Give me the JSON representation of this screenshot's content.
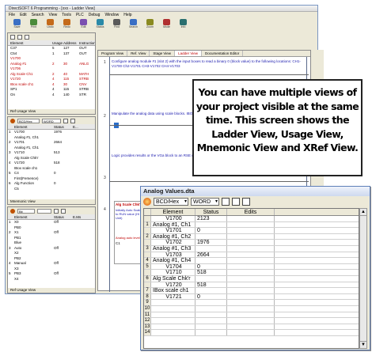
{
  "app": {
    "title": "DirectSOFT 6 Programming - [xxx - Ladder View]",
    "menu": [
      "File",
      "Edit",
      "Search",
      "View",
      "Tools",
      "PLC",
      "Debug",
      "Window",
      "Help"
    ],
    "toolbar": [
      {
        "label": "Save",
        "icon": "save-icon"
      },
      {
        "label": "Print",
        "icon": "print-icon"
      },
      {
        "label": "Undo",
        "icon": "undo-icon"
      },
      {
        "label": "Redo",
        "icon": "redo-icon"
      },
      {
        "label": "Edit",
        "icon": "edit-icon"
      },
      {
        "label": "Status",
        "icon": "status-icon"
      },
      {
        "label": "Find",
        "icon": "find-icon"
      },
      {
        "label": "Search",
        "icon": "search-icon"
      },
      {
        "label": "Zoom",
        "icon": "zoom-icon"
      },
      {
        "label": "Mode",
        "icon": "mode-icon"
      },
      {
        "label": "Info",
        "icon": "info-icon"
      }
    ],
    "colors": {
      "accent": "#c00000",
      "comment": "#2020b0",
      "panel": "#ece9d8"
    }
  },
  "usage": {
    "headers": [
      "Element",
      "Usage",
      "Address",
      "Instruction"
    ],
    "rows": [
      {
        "element": "C37",
        "usage": "5",
        "address": "127",
        "instr": "OUT",
        "red": false
      },
      {
        "element": "C54",
        "usage": "1",
        "address": "137",
        "instr": "OUT",
        "red": false
      },
      {
        "element": "V1700",
        "usage": "",
        "address": "",
        "instr": "",
        "red": true
      },
      {
        "element": "Analog #1",
        "usage": "2",
        "address": "30",
        "instr": "ANLG",
        "red": true
      },
      {
        "element": "V1706",
        "usage": "",
        "address": "",
        "instr": "",
        "red": true
      },
      {
        "element": "Alg Scale Ch1",
        "usage": "2",
        "address": "40",
        "instr": "MATH",
        "red": true
      },
      {
        "element": "V1720",
        "usage": "4",
        "address": "115",
        "instr": "STRB",
        "red": true
      },
      {
        "element": "IBox scale ch1",
        "usage": "4",
        "address": "30",
        "instr": "CNV",
        "red": true
      },
      {
        "element": "SP1",
        "usage": "4",
        "address": "115",
        "instr": "STRB",
        "red": false
      },
      {
        "element": "On",
        "usage": "4",
        "address": "140",
        "instr": "STR",
        "red": false
      }
    ],
    "status": "Ref Usage View"
  },
  "mnemonic": {
    "format": "BCD/Hex",
    "type": "WORD",
    "headers": [
      "Element",
      "Status",
      "E..."
    ],
    "rows": [
      {
        "n": "1",
        "element": "V1700",
        "status": "1976"
      },
      {
        "n": "",
        "element": "Analog #1, Ch1",
        "status": ""
      },
      {
        "n": "2",
        "element": "V1701",
        "status": "2664"
      },
      {
        "n": "",
        "element": "Analog #1, Ch1",
        "status": ""
      },
      {
        "n": "3",
        "element": "V1710",
        "status": "513"
      },
      {
        "n": "",
        "element": "Alg Scale Chk'r",
        "status": ""
      },
      {
        "n": "4",
        "element": "V1720",
        "status": "518"
      },
      {
        "n": "",
        "element": "IBox scale ch1",
        "status": ""
      },
      {
        "n": "5",
        "element": "C4",
        "status": "0"
      },
      {
        "n": "",
        "element": "First(Femence)",
        "status": ""
      },
      {
        "n": "6",
        "element": "Alg Function",
        "status": "0"
      },
      {
        "n": "",
        "element": "C5",
        "status": ""
      }
    ],
    "status": "Mnemonic View"
  },
  "xref": {
    "format": "Bit",
    "headers": [
      "Element",
      "Status",
      "E.Ms"
    ],
    "rows": [
      {
        "n": "1",
        "element": "X0",
        "status": "Off"
      },
      {
        "n": "",
        "element": "PB0",
        "status": ""
      },
      {
        "n": "2",
        "element": "X1",
        "status": "Off"
      },
      {
        "n": "",
        "element": "PB1",
        "status": ""
      },
      {
        "n": "",
        "element": "Blue",
        "status": ""
      },
      {
        "n": "3",
        "element": "Auto",
        "status": "Off"
      },
      {
        "n": "",
        "element": "X2",
        "status": ""
      },
      {
        "n": "",
        "element": "PB2",
        "status": ""
      },
      {
        "n": "4",
        "element": "Manual",
        "status": "Off"
      },
      {
        "n": "",
        "element": "X3",
        "status": ""
      },
      {
        "n": "5",
        "element": "PB3",
        "status": "Off"
      },
      {
        "n": "",
        "element": "X4",
        "status": ""
      }
    ],
    "status": "Ref Usage View"
  },
  "ladder": {
    "tabs": [
      "Program View",
      "Ref. View",
      "Stage View",
      "Ladder View",
      "Documentation Editor"
    ],
    "active_tab": 3,
    "rung1_comment": "Configure analog module #1 (slot 2) with the input boxes to read a binary 0 (block value) to the following locations: CH1-V1700  Ch2-V1701  CH3-V1702  CH4-V1703",
    "rung2_comment": "Manipulate the analog data using scale blocks. IBOx, Convert to math blocks.",
    "rung3_comment": "Logic provides results or the VGa block to an RSE registers required to convert. And only loads.",
    "rung_numbers": [
      "1",
      "2",
      "3",
      "4"
    ],
    "box_label": "Alg Scale Chk'r",
    "box_text": "Initially Auto Scale to RUN value (Hi Unit)",
    "out_label": "Analog auto level",
    "out_coil": "C1"
  },
  "callout": {
    "text": "You can have multiple views of your project visible at the same time. This screen shows the Ladder View, Usage View, Mnemonic View and XRef View."
  },
  "analog_window": {
    "title": "Analog Values.dta",
    "format": "BCD/Hex",
    "type": "WORD",
    "headers": [
      "Element",
      "Status",
      "Edits"
    ],
    "rows": [
      {
        "n": "",
        "element": "V1700",
        "status": "2123"
      },
      {
        "n": "1",
        "element": "Analog #1, Ch1",
        "status": ""
      },
      {
        "n": "",
        "element": "V1701",
        "status": "0"
      },
      {
        "n": "2",
        "element": "Analog #1, Ch2",
        "status": ""
      },
      {
        "n": "",
        "element": "V1702",
        "status": "1976"
      },
      {
        "n": "3",
        "element": "Analog #1, Ch3",
        "status": ""
      },
      {
        "n": "",
        "element": "V1703",
        "status": "2664"
      },
      {
        "n": "4",
        "element": "Analog #1, Ch4",
        "status": ""
      },
      {
        "n": "5",
        "element": "V1704",
        "status": "0"
      },
      {
        "n": "",
        "element": "V1710",
        "status": "518"
      },
      {
        "n": "6",
        "element": "Alg Scale Chk'r",
        "status": ""
      },
      {
        "n": "",
        "element": "V1720",
        "status": "518"
      },
      {
        "n": "7",
        "element": "IBox scale ch1",
        "status": ""
      },
      {
        "n": "8",
        "element": "V1721",
        "status": "0"
      },
      {
        "n": "9",
        "element": "",
        "status": ""
      },
      {
        "n": "10",
        "element": "",
        "status": ""
      },
      {
        "n": "11",
        "element": "",
        "status": ""
      },
      {
        "n": "12",
        "element": "",
        "status": ""
      },
      {
        "n": "13",
        "element": "",
        "status": ""
      },
      {
        "n": "14",
        "element": "",
        "status": ""
      }
    ]
  }
}
